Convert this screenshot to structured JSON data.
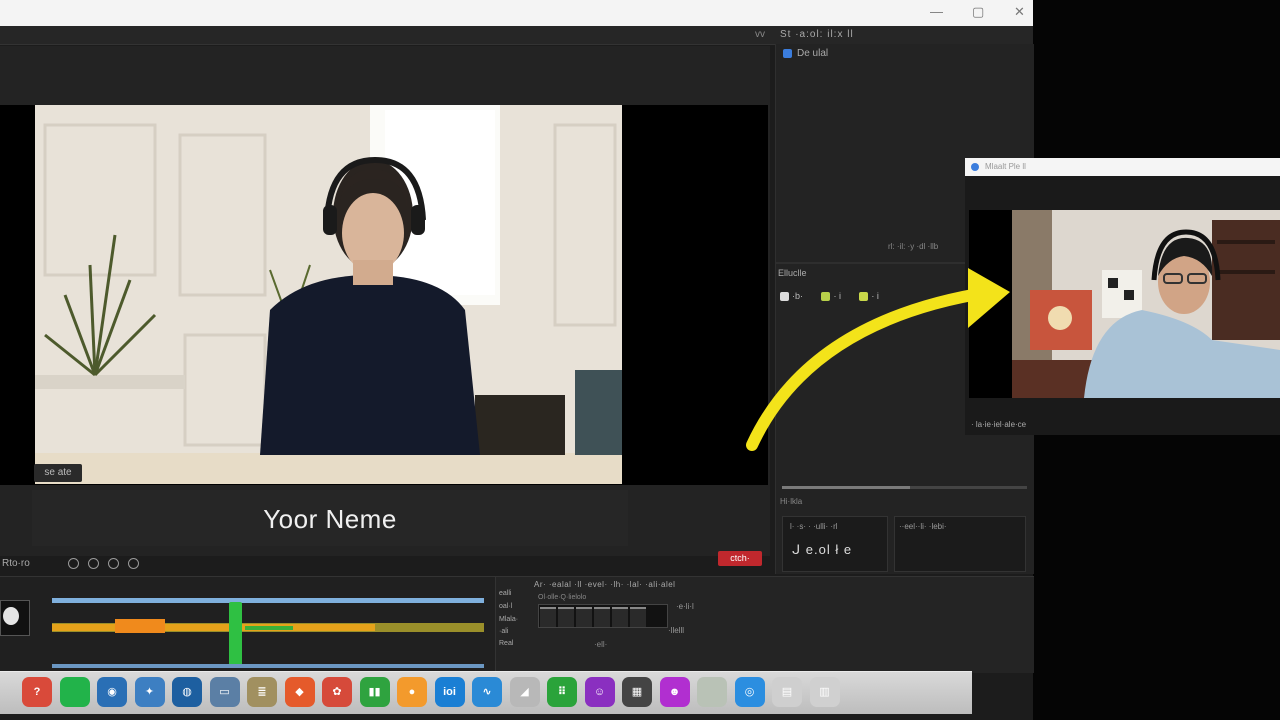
{
  "preview": {
    "lower_third_name": "Yoor Neme",
    "scene_label": "se ate"
  },
  "menu": {
    "version": "vv",
    "right_text": "St ·a:ol: il:x ll"
  },
  "right_panel": {
    "tab_label": "De ulal",
    "mini_text": "rl: ·il: ·y ·dl ·llb",
    "section_label": "Elluclle",
    "chips": [
      "·b·",
      "· i",
      "· i"
    ],
    "slider_label": "Hi·lkla",
    "box1_title": "l· ·s· · ·ulli· ·rl",
    "box1_value": "ᒍ e.ol ł e",
    "box2_title": "··eel··li· ·lebi·"
  },
  "controls": {
    "time": "Rto·ro",
    "rec_label": "ctch·"
  },
  "timeline": {
    "track_label": ""
  },
  "mixer": {
    "header": "Ar· ·ealal ·ll ·evel· ·lh· ·lal· ·ali·alel",
    "sub": "Ol·olle·Q·lielolo",
    "labels": [
      "ealli",
      "oal·l",
      "Mlala·",
      "·ali",
      "Real"
    ],
    "v1": "·e·li·l",
    "v2": "·llelll",
    "v3": "·ell·"
  },
  "floating": {
    "title": "Mlaalt Ple ll",
    "caption": "· la·ie·iel·ale·ce"
  },
  "dock": {
    "icons": [
      {
        "name": "help-icon",
        "glyph": "?",
        "color": "#d94a3a"
      },
      {
        "name": "green-circle-icon",
        "glyph": "",
        "color": "#22b34a"
      },
      {
        "name": "globe-icon",
        "glyph": "◉",
        "color": "#2a6fb5"
      },
      {
        "name": "compass-icon",
        "glyph": "✦",
        "color": "#3d7fc2"
      },
      {
        "name": "dial-icon",
        "glyph": "◍",
        "color": "#1d5fa0"
      },
      {
        "name": "preview-icon",
        "glyph": "▭",
        "color": "#5b7fa5"
      },
      {
        "name": "notes-icon",
        "glyph": "≣",
        "color": "#a19060"
      },
      {
        "name": "orange-app-icon",
        "glyph": "◆",
        "color": "#e55a2b"
      },
      {
        "name": "photos-icon",
        "glyph": "✿",
        "color": "#d64a3a"
      },
      {
        "name": "chart-icon",
        "glyph": "▮▮",
        "color": "#2fa33f"
      },
      {
        "name": "orange-ball-icon",
        "glyph": "●",
        "color": "#f39a2c"
      },
      {
        "name": "blue-app-icon",
        "glyph": "ioi",
        "color": "#1a7fd4"
      },
      {
        "name": "wave-icon",
        "glyph": "∿",
        "color": "#2a8ad6"
      },
      {
        "name": "paper-icon",
        "glyph": "◢",
        "color": "#b8b8b8"
      },
      {
        "name": "green-grid-icon",
        "glyph": "⠿",
        "color": "#2aa33a"
      },
      {
        "name": "purple-icon",
        "glyph": "☺",
        "color": "#8a2fc0"
      },
      {
        "name": "photo-strip-icon",
        "glyph": "▦",
        "color": "#444444"
      },
      {
        "name": "magenta-icon",
        "glyph": "☻",
        "color": "#b12fd0"
      },
      {
        "name": "blank-app-icon",
        "glyph": "",
        "color": "#b9c2b6"
      },
      {
        "name": "safari-icon",
        "glyph": "◎",
        "color": "#2b8ee0"
      },
      {
        "name": "folder-icon",
        "glyph": "▤",
        "color": "#cfcfcf"
      },
      {
        "name": "trash-icon",
        "glyph": "▥",
        "color": "#d0d0d0"
      }
    ]
  }
}
